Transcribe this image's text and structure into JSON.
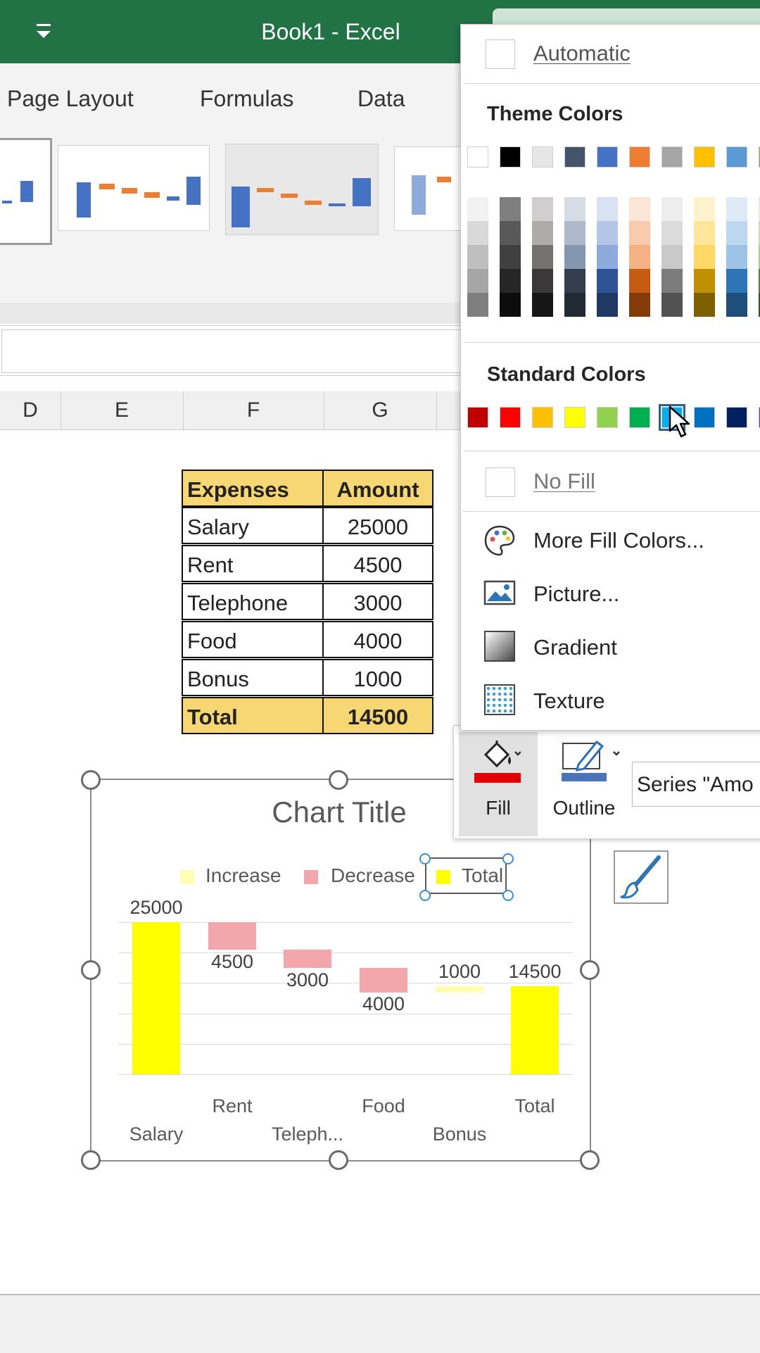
{
  "window": {
    "title": "Book1  -  Excel"
  },
  "ribbon": {
    "tabs": [
      "Page Layout",
      "Formulas",
      "Data"
    ]
  },
  "columns": [
    "D",
    "E",
    "F",
    "G"
  ],
  "table": {
    "headers": [
      "Expenses",
      "Amount"
    ],
    "rows": [
      {
        "label": "Salary",
        "value": "25000"
      },
      {
        "label": "Rent",
        "value": "4500"
      },
      {
        "label": "Telephone",
        "value": "3000"
      },
      {
        "label": "Food",
        "value": "4000"
      },
      {
        "label": "Bonus",
        "value": "1000"
      }
    ],
    "total": {
      "label": "Total",
      "value": "14500"
    }
  },
  "chart": {
    "title": "Chart Title",
    "legend": [
      "Increase",
      "Decrease",
      "Total"
    ]
  },
  "chart_data": {
    "type": "bar",
    "title": "Chart Title",
    "categories": [
      "Salary",
      "Rent",
      "Telephone",
      "Food",
      "Bonus",
      "Total"
    ],
    "tick_labels": [
      "Salary",
      "Rent",
      "Teleph...",
      "Food",
      "Bonus",
      "Total"
    ],
    "data_labels": [
      "25000",
      "4500",
      "3000",
      "4000",
      "1000",
      "14500"
    ],
    "series": [
      {
        "name": "Total",
        "values": [
          25000,
          null,
          null,
          null,
          null,
          14500
        ],
        "color": "#ffff00"
      },
      {
        "name": "Decrease",
        "start": [
          null,
          25000,
          20500,
          17500,
          null,
          null
        ],
        "end": [
          null,
          20500,
          17500,
          13500,
          null,
          null
        ],
        "color": "#f4a6ad"
      },
      {
        "name": "Increase",
        "start": [
          null,
          null,
          null,
          null,
          13500,
          null
        ],
        "end": [
          null,
          null,
          null,
          null,
          14500,
          null
        ],
        "color": "#ffffb3"
      }
    ],
    "ylim": [
      0,
      25000
    ],
    "grid": true,
    "legend_position": "top"
  },
  "mini_toolbar": {
    "fill_label": "Fill",
    "outline_label": "Outline",
    "series_selector": "Series \"Amo"
  },
  "fill_menu": {
    "automatic": "Automatic",
    "theme_heading": "Theme Colors",
    "theme_base": [
      "#ffffff",
      "#000000",
      "#e7e6e6",
      "#44546a",
      "#4472c4",
      "#ed7d31",
      "#a5a5a5",
      "#ffc000",
      "#5b9bd5",
      "#70ad47"
    ],
    "theme_shades": [
      [
        "#f2f2f2",
        "#d9d9d9",
        "#bfbfbf",
        "#a6a6a6",
        "#7f7f7f"
      ],
      [
        "#7f7f7f",
        "#595959",
        "#404040",
        "#262626",
        "#0d0d0d"
      ],
      [
        "#d0cece",
        "#aeabab",
        "#757171",
        "#3a3838",
        "#171616"
      ],
      [
        "#d6dce4",
        "#adb9ca",
        "#8497b0",
        "#333f4f",
        "#222a35"
      ],
      [
        "#d9e2f3",
        "#b4c6e7",
        "#8eaadb",
        "#2f5496",
        "#1f3864"
      ],
      [
        "#fbe5d5",
        "#f7cbac",
        "#f4b183",
        "#c55a11",
        "#843c0b"
      ],
      [
        "#ededed",
        "#dbdbdb",
        "#c9c9c9",
        "#7b7b7b",
        "#525252"
      ],
      [
        "#fff2cc",
        "#ffe699",
        "#ffd966",
        "#bf9000",
        "#7f6000"
      ],
      [
        "#deebf6",
        "#bdd7ee",
        "#9dc3e6",
        "#2e75b5",
        "#1e4e79"
      ],
      [
        "#e2efd9",
        "#c5e0b3",
        "#a8d08d",
        "#538135",
        "#375623"
      ]
    ],
    "standard_heading": "Standard Colors",
    "standard": [
      "#c00000",
      "#ff0000",
      "#ffc000",
      "#ffff00",
      "#92d050",
      "#00b050",
      "#00b0f0",
      "#0070c0",
      "#002060",
      "#7030a0"
    ],
    "no_fill": "No Fill",
    "more_colors": "More Fill Colors...",
    "picture": "Picture...",
    "gradient": "Gradient",
    "texture": "Texture"
  },
  "icons": [
    "quick-access-icon",
    "palette-icon",
    "picture-icon",
    "gradient-icon",
    "texture-icon",
    "fill-bucket-icon",
    "outline-pen-icon",
    "brush-icon",
    "mouse-cursor-icon"
  ]
}
